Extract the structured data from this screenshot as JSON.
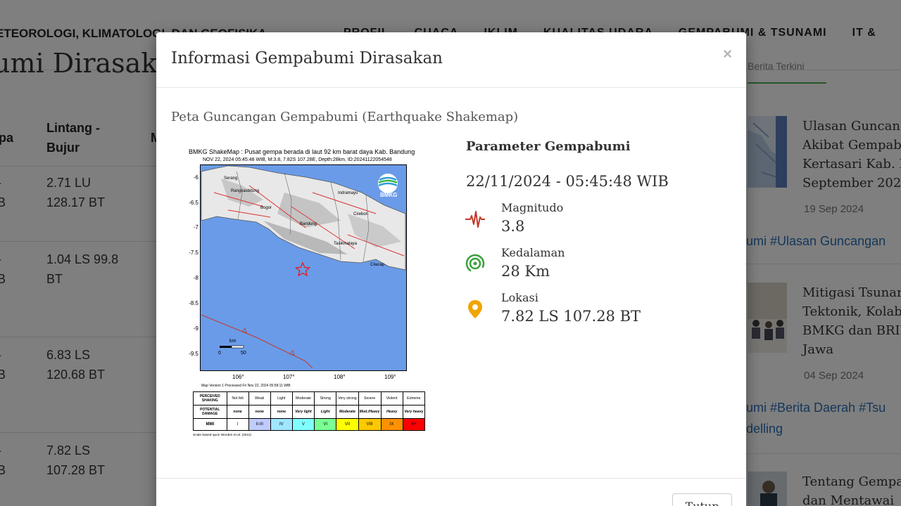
{
  "background": {
    "brand_name": "ETEOROLOGI, KLIMATOLOGI, DAN GEOFISIKA",
    "nav": [
      "PROFIL",
      "CUACA",
      "IKLIM",
      "KUALITAS UDARA",
      "GEMPABUMI & TSUNAMI",
      "IT &"
    ],
    "page_heading": "umi Dirasakan",
    "tab_label": "Berita Terkini",
    "table": {
      "headers": [
        "pa",
        "Lintang - Bujur",
        "M"
      ],
      "rows": [
        {
          "col1": "-",
          "col1b": "B",
          "latlon": "2.71 LU",
          "latlon2": "128.17 BT"
        },
        {
          "col1": "-",
          "col1b": "B",
          "latlon": "1.04 LS 99.8",
          "latlon2": "BT"
        },
        {
          "col1": "-",
          "col1b": "B",
          "latlon": "6.83 LS",
          "latlon2": "120.68 BT"
        },
        {
          "col1": "-",
          "col1b": "B",
          "latlon": "7.82 LS",
          "latlon2": "107.28 BT"
        }
      ]
    },
    "news": [
      {
        "lines": [
          "Ulasan Guncan",
          "Akibat Gempab",
          "Kertasari Kab. K",
          "September 2024"
        ],
        "date": "19 Sep 2024",
        "tags": [
          "umi #Ulasan Guncangan"
        ]
      },
      {
        "lines": [
          "Mitigasi Tsunar",
          "Tektonik, Kolab",
          "BMKG dan BRIN",
          "Jawa"
        ],
        "date": "04 Sep 2024",
        "tags": [
          "umi #Berita Daerah #Tsu",
          "delling"
        ]
      },
      {
        "lines": [
          "Tentang Gempa",
          "dan Mentawai"
        ]
      }
    ]
  },
  "modal": {
    "title": "Informasi Gempabumi Dirasakan",
    "close_symbol": "×",
    "subtitle": "Peta Guncangan Gempabumi (Earthquake Shakemap)",
    "footer_button": "Tutup",
    "shakemap": {
      "title": "BMKG ShakeMap : Pusat gempa berada di laut 92 km barat daya Kab. Bandung",
      "subtitle": "NOV 22, 2024 05:45:48 WIB, M:3.8, 7.82S 107.28E, Depth:28km, ID:20241122054548",
      "logo_text": "BMKG",
      "lat_ticks": [
        "-6",
        "-6.5",
        "-7",
        "-7.5",
        "-8",
        "-8.5",
        "-9",
        "-9.5"
      ],
      "lon_ticks": [
        "106°",
        "107°",
        "108°",
        "109°"
      ],
      "cities": [
        "Serang",
        "Rangkasbitung",
        "Bogor",
        "Indramayu",
        "Cirebon",
        "Bandung",
        "Tasikmalaya",
        "Cilacap"
      ],
      "scale_label": "km",
      "scale_ticks": [
        "0",
        "50"
      ],
      "map_version": "Map Version 1 Processed Fri Nov 22, 2024 05:58:11 WIB",
      "mmi_table": {
        "row_headers": [
          "PERCEIVED SHAKING",
          "POTENTIAL DAMAGE",
          "MMI"
        ],
        "shaking": [
          "Not felt",
          "Weak",
          "Light",
          "Moderate",
          "Strong",
          "Very strong",
          "Severe",
          "Violent",
          "Extreme"
        ],
        "damage": [
          "none",
          "none",
          "none",
          "Very light",
          "Light",
          "Moderate",
          "Mod./Heavy",
          "Heavy",
          "Very heavy"
        ],
        "mmi": [
          "I",
          "II-III",
          "IV",
          "V",
          "VI",
          "VII",
          "VIII",
          "IX",
          "X+"
        ],
        "mmi_colors": [
          "#ffffff",
          "#bfccff",
          "#a0e6ff",
          "#80ffff",
          "#7aff93",
          "#ffff00",
          "#ffc800",
          "#ff9100",
          "#ff0000"
        ]
      },
      "scale_note": "Scale based upon Worden et al. (2011)"
    },
    "parameters": {
      "title": "Parameter Gempabumi",
      "datetime": "22/11/2024 - 05:45:48 WIB",
      "magnitude_label": "Magnitudo",
      "magnitude_value": "3.8",
      "magnitude_icon": "seismograph-icon",
      "depth_label": "Kedalaman",
      "depth_value": "28 Km",
      "depth_icon": "depth-rings-icon",
      "location_label": "Lokasi",
      "location_value": "7.82 LS 107.28 BT",
      "location_icon": "map-pin-icon"
    }
  },
  "colors": {
    "magnitude_icon": "#c0392b",
    "depth_icon": "#3aa13a",
    "location_icon": "#f0a500",
    "ocean": "#6a9be8",
    "tab_accent": "#4caf50",
    "tag_link": "#2a6fb5"
  }
}
